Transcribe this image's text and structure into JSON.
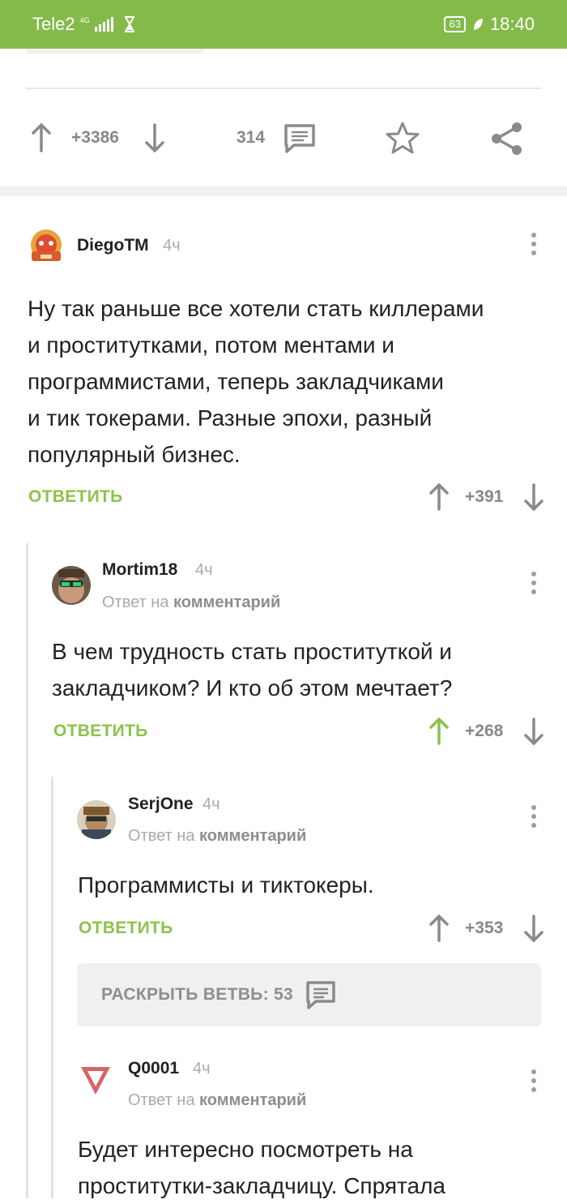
{
  "status": {
    "carrier": "Tele2",
    "network": "4G",
    "battery": "63",
    "time": "18:40"
  },
  "post_actions": {
    "rating": "+3386",
    "comments_count": "314"
  },
  "comments": [
    {
      "author": "DiegoTM",
      "time": "4ч",
      "reply_to": "",
      "text": "Ну так раньше все хотели стать киллерами и проститутками, потом ментами и программистами, теперь закладчиками и тик токерами. Разные эпохи, разный популярный бизнес.",
      "lines": [
        "Ну так раньше все хотели стать киллерами",
        "и проститутками, потом ментами и",
        "программистами, теперь закладчиками",
        "и тик токерами. Разные эпохи, разный",
        "популярный бизнес."
      ],
      "answer_label": "ОТВЕТИТЬ",
      "score": "+391"
    },
    {
      "author": "Mortim18",
      "time": "4ч",
      "reply_prefix": "Ответ на",
      "reply_target": "комментарий",
      "lines": [
        "В чем трудность стать проституткой и",
        "закладчиком? И кто об этом мечтает?"
      ],
      "answer_label": "ОТВЕТИТЬ",
      "score": "+268"
    },
    {
      "author": "SerjOne",
      "time": "4ч",
      "reply_prefix": "Ответ на",
      "reply_target": "комментарий",
      "lines": [
        "Программисты и тиктокеры."
      ],
      "answer_label": "ОТВЕТИТЬ",
      "score": "+353"
    },
    {
      "author": "Q0001",
      "time": "4ч",
      "reply_prefix": "Ответ на",
      "reply_target": "комментарий",
      "lines": [
        "Будет интересно посмотреть на",
        "проститутки-закладчицу. Спрятала"
      ]
    }
  ],
  "expand_branch": {
    "label": "РАСКРЫТЬ ВЕТВЬ: 53"
  },
  "colors": {
    "accent_green": "#8bc34a",
    "status_bar": "#84ba4a",
    "icon_gray": "#8a8a8a"
  }
}
